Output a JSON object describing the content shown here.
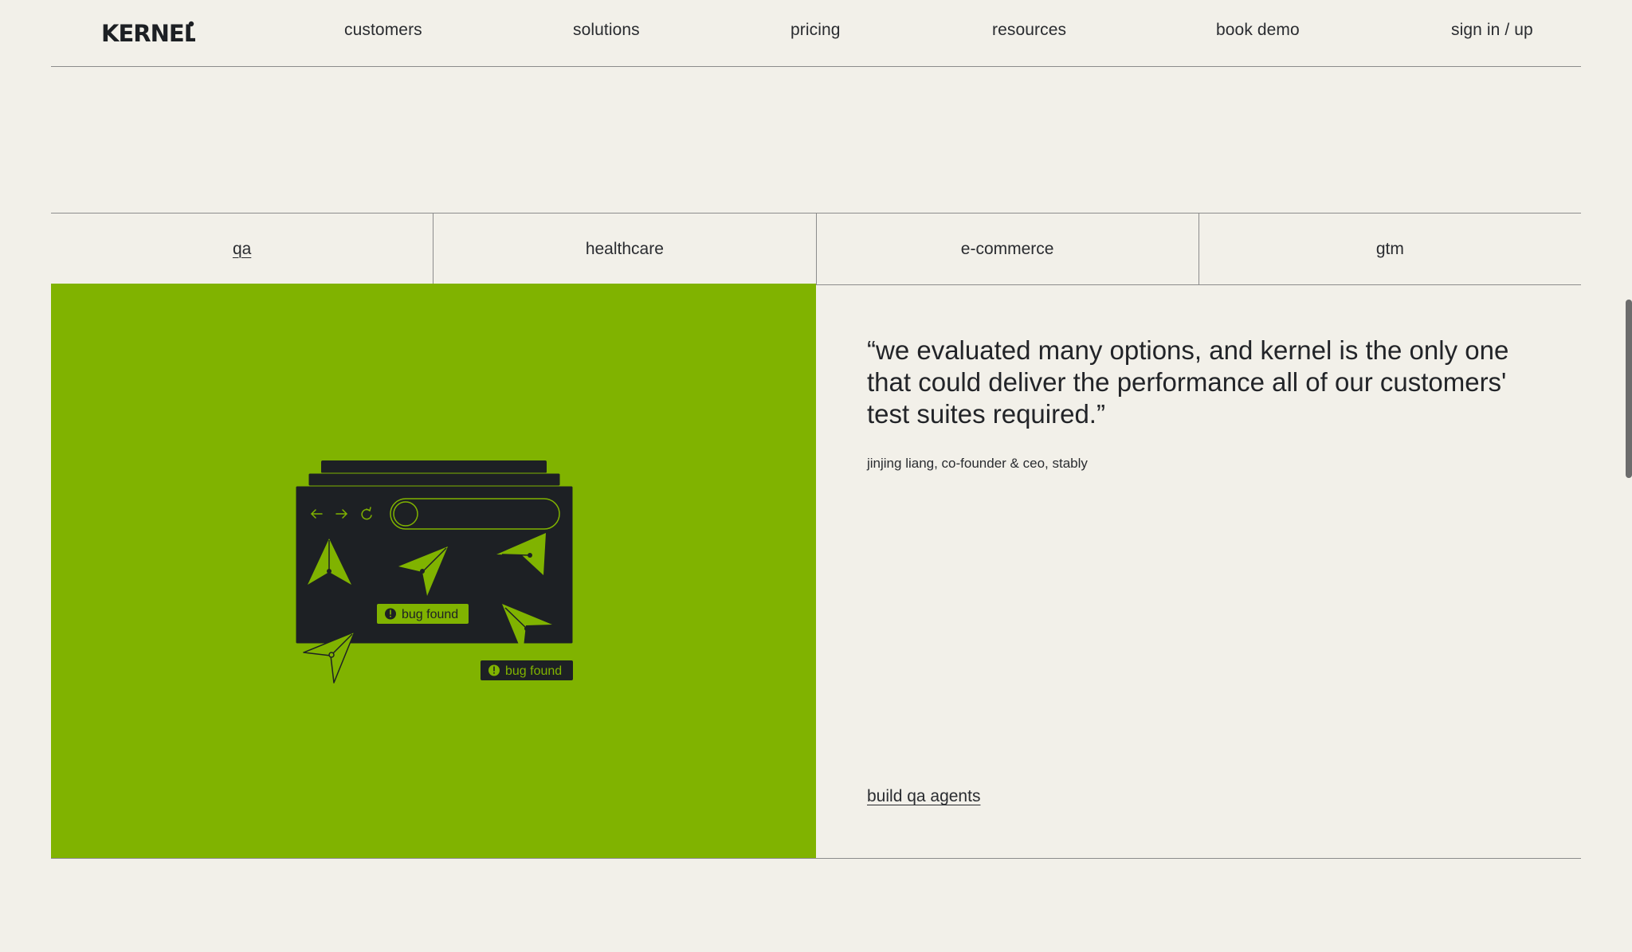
{
  "brand": {
    "logo_text": "KERNEL",
    "accent_color": "#80b300",
    "dark_color": "#1d2024"
  },
  "nav": {
    "items": [
      {
        "label": "customers"
      },
      {
        "label": "solutions"
      },
      {
        "label": "pricing"
      },
      {
        "label": "resources"
      },
      {
        "label": "book demo"
      },
      {
        "label": "sign in / up"
      }
    ]
  },
  "tabs": [
    {
      "label": "qa",
      "active": true
    },
    {
      "label": "healthcare",
      "active": false
    },
    {
      "label": "e-commerce",
      "active": false
    },
    {
      "label": "gtm",
      "active": false
    }
  ],
  "feature": {
    "illustration": {
      "nav_icons": [
        "arrow-left-icon",
        "arrow-right-icon",
        "refresh-icon"
      ],
      "badges": [
        "bug found",
        "bug found"
      ]
    },
    "quote": "“we evaluated many options, and kernel is the only one that could deliver the performance all of our customers' test suites required.”",
    "attribution": "jinjing liang, co-founder & ceo, stably",
    "cta_label": "build qa agents"
  }
}
